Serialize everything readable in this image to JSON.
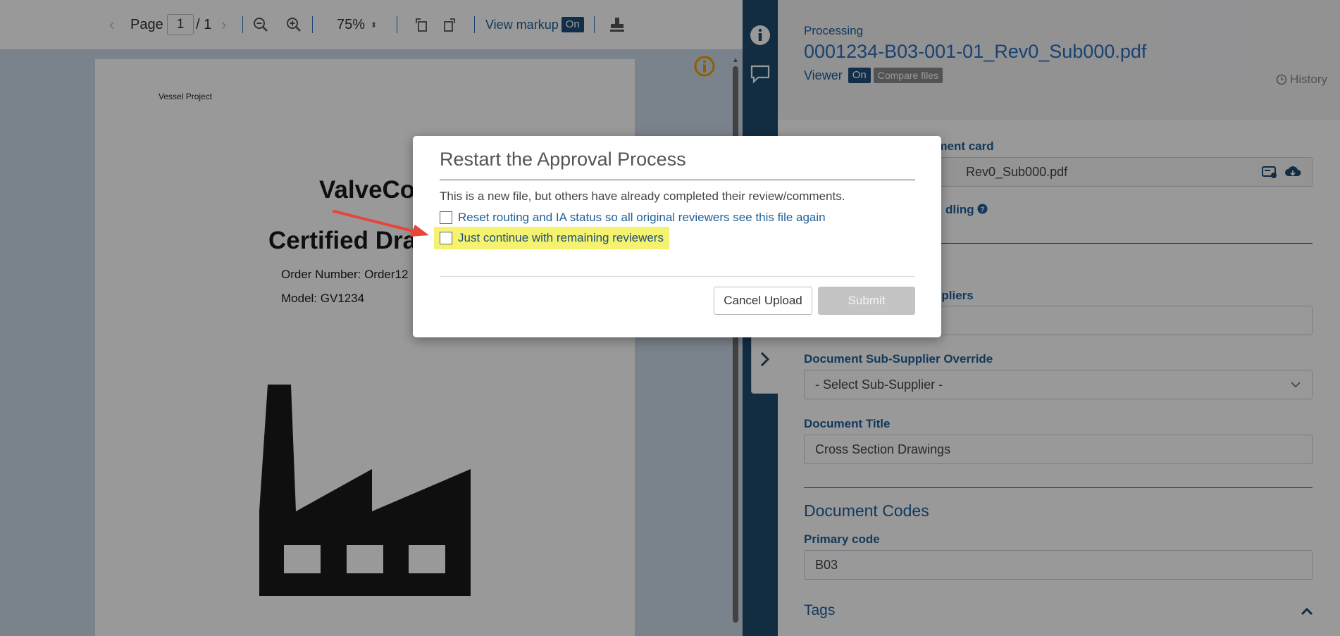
{
  "viewer_toolbar": {
    "page_label": "Page",
    "page_current": "1",
    "page_total": "/ 1",
    "zoom": "75%",
    "view_markup_label": "View markup",
    "view_markup_state": "On"
  },
  "document": {
    "header": "Vessel Project",
    "company": "ValveCo",
    "title": "Certified Draw",
    "order_number": "Order Number: Order12",
    "model": "Model: GV1234"
  },
  "right_panel": {
    "status": "Processing",
    "filename": "0001234-B03-001-01_Rev0_Sub000.pdf",
    "viewer_label": "Viewer",
    "viewer_state": "On",
    "compare_label": "Compare files",
    "history_label": "History",
    "doc_card_label": "ument card",
    "doc_card_value": "Rev0_Sub000.pdf",
    "handling_label": "dling",
    "suppliers_label": "ppliers",
    "sub_supplier_label": "Document Sub-Supplier Override",
    "sub_supplier_value": "- Select Sub-Supplier -",
    "doc_title_label": "Document Title",
    "doc_title_value": "Cross Section Drawings",
    "doc_codes_heading": "Document Codes",
    "primary_code_label": "Primary code",
    "primary_code_value": "B03",
    "tags_heading": "Tags"
  },
  "modal": {
    "title": "Restart the Approval Process",
    "description": "This is a new file, but others have already completed their review/comments.",
    "option_reset": "Reset routing and IA status so all original reviewers see this file again",
    "option_continue": "Just continue with remaining reviewers",
    "cancel_label": "Cancel Upload",
    "submit_label": "Submit"
  },
  "colors": {
    "brand_blue": "#1f5f99",
    "rail": "#1e4a6e",
    "highlight": "#f4f26e",
    "arrow": "#e8453c",
    "info_badge": "#f0a000"
  }
}
